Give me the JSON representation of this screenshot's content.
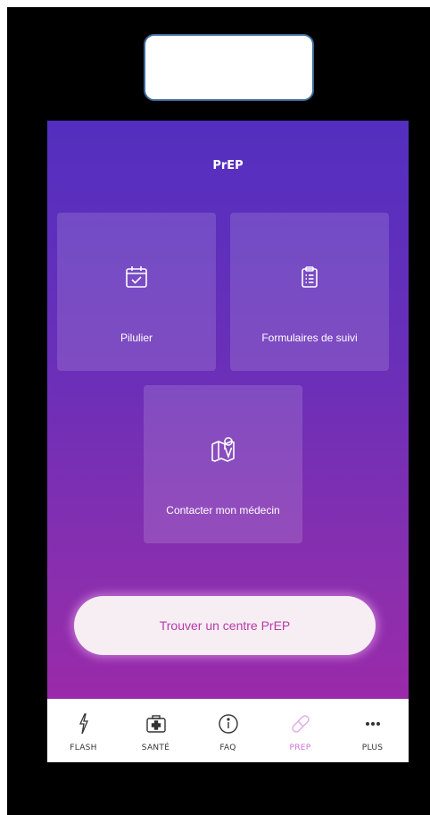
{
  "header": {
    "title": "PrEP"
  },
  "tiles": [
    {
      "label": "Pilulier",
      "icon": "calendar-check-icon"
    },
    {
      "label": "Formulaires de suivi",
      "icon": "clipboard-list-icon"
    },
    {
      "label": "Contacter mon médecin",
      "icon": "map-pin-icon"
    }
  ],
  "cta": {
    "label": "Trouver un centre PrEP"
  },
  "tabbar": {
    "items": [
      {
        "label": "FLASH",
        "icon": "lightning-icon",
        "active": false
      },
      {
        "label": "SANTÉ",
        "icon": "medical-kit-icon",
        "active": false
      },
      {
        "label": "FAQ",
        "icon": "info-icon",
        "active": false
      },
      {
        "label": "PREP",
        "icon": "pill-icon",
        "active": true
      },
      {
        "label": "PLUS",
        "icon": "more-dots-icon",
        "active": false
      }
    ]
  },
  "colors": {
    "gradient_top": "#532fbf",
    "gradient_bottom": "#9a2aa9",
    "accent": "#b53aa8",
    "active_tab": "#d070d8"
  }
}
